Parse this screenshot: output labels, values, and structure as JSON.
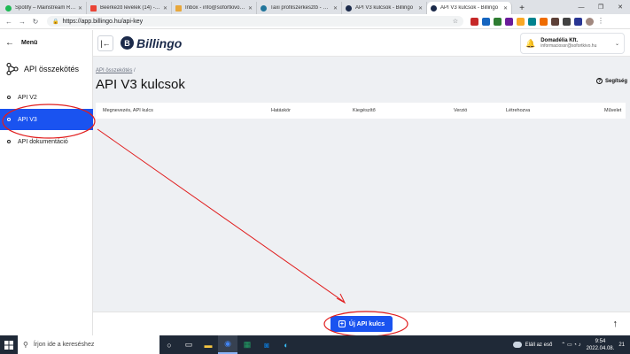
{
  "browser": {
    "tabs": [
      {
        "label": "Spotify – Mainstream Rap",
        "color": "#1db954",
        "active": false
      },
      {
        "label": "Beérkező levelek (14) - jen...",
        "color": "#ea4335",
        "active": false
      },
      {
        "label": "Inbox - info@sofortkivo.hu",
        "color": "#e8a73a",
        "active": false
      },
      {
        "label": "Taxi profilszerkesztő - Sofor...",
        "color": "#21759b",
        "active": false
      },
      {
        "label": "API V3 kulcsok - Billingo",
        "color": "#1b2a4a",
        "active": false
      },
      {
        "label": "API V3 kulcsok - Billingo",
        "color": "#1b2a4a",
        "active": true
      }
    ],
    "new_tab": "+",
    "url": "https://app.billingo.hu/api-key"
  },
  "sidebar": {
    "menu_label": "Menü",
    "section_title": "API összekötés",
    "items": [
      {
        "label": "API V2",
        "active": false
      },
      {
        "label": "API V3",
        "active": true
      },
      {
        "label": "API dokumentáció",
        "active": false
      }
    ]
  },
  "header": {
    "logo_text": "Billingo",
    "user_name": "Domadélia Kft.",
    "user_email": "informaciossr@sofortkivo.hu"
  },
  "main": {
    "breadcrumb": "API összekötés",
    "breadcrumb_sep": "/",
    "title": "API V3 kulcsok",
    "help_label": "Segítség",
    "columns": [
      "Megnevezés, API kulcs",
      "Hatáskör",
      "Kiegészítő",
      "Verzió",
      "Létrehozva",
      "Művelet"
    ]
  },
  "footer": {
    "new_key_label": "Új API kulcs"
  },
  "taskbar": {
    "search_placeholder": "Írjon ide a kereséshez",
    "weather": "Eláll az eső",
    "time": "9:54",
    "date": "2022.04.08.",
    "notif_count": "21"
  },
  "colors": {
    "accent": "#1a53f0",
    "annotation": "#e11d1d"
  }
}
